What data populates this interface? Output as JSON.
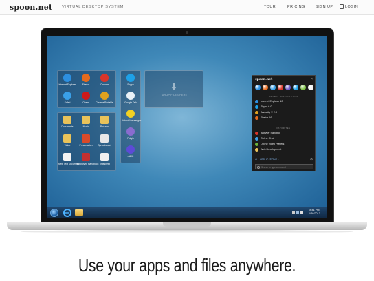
{
  "header": {
    "logo": "spoon.net",
    "tagline": "VIRTUAL DESKTOP SYSTEM",
    "nav": {
      "tour": "TOUR",
      "pricing": "PRICING",
      "signup": "SIGN UP",
      "login": "LOGIN"
    }
  },
  "desktop": {
    "group_browsers": [
      {
        "label": "Internet Explorer",
        "icon": "ie-icon",
        "color": "#2d8fe0"
      },
      {
        "label": "Firefox",
        "icon": "firefox-icon",
        "color": "#e66a1c"
      },
      {
        "label": "Chrome",
        "icon": "chrome-icon",
        "color": "#d8352a"
      },
      {
        "label": "Safari",
        "icon": "safari-icon",
        "color": "#3aa0e8"
      },
      {
        "label": "Opera",
        "icon": "opera-icon",
        "color": "#cc1a1a"
      },
      {
        "label": "Chrome Portable",
        "icon": "chrome-icon",
        "color": "#e0a21f"
      }
    ],
    "group_social": [
      {
        "label": "Skype",
        "icon": "skype-icon",
        "color": "#1ea1e8"
      },
      {
        "label": "Google Talk",
        "icon": "chat-icon",
        "color": "#e9f1f7"
      },
      {
        "label": "Yahoo! Messenger",
        "icon": "yahoo-icon",
        "color": "#f3d223"
      },
      {
        "label": "Pidgin",
        "icon": "pidgin-icon",
        "color": "#8a6ccf"
      },
      {
        "label": "mIRC",
        "icon": "mirc-icon",
        "color": "#5d4bd6"
      }
    ],
    "group_documents": [
      {
        "label": "Documents",
        "icon": "folder-icon",
        "color": "#e9c35a"
      },
      {
        "label": "Music",
        "icon": "folder-icon",
        "color": "#e9c35a"
      },
      {
        "label": "Pictures",
        "icon": "folder-icon",
        "color": "#e9c35a"
      },
      {
        "label": "Video",
        "icon": "folder-icon",
        "color": "#e9c35a"
      },
      {
        "label": "Presentation",
        "icon": "document-icon",
        "color": "#d94a2a"
      },
      {
        "label": "Spreadsheet",
        "icon": "document-icon",
        "color": "#e8e8e8"
      },
      {
        "label": "New Text Document",
        "icon": "document-icon",
        "color": "#f2f2f2"
      },
      {
        "label": "Employee Handbook",
        "icon": "document-icon",
        "color": "#c23030"
      },
      {
        "label": "Timesheet",
        "icon": "document-icon",
        "color": "#f0f0f0"
      }
    ],
    "drop_zone_label": "DROP FILES HERE"
  },
  "app_panel": {
    "logo": "spoon.net",
    "close": "×",
    "sections": [
      "RECENT APPLICATIONS",
      "FAVORITES"
    ],
    "recent": [
      {
        "label": "Internet Explorer 10",
        "color": "#2d8fe0"
      },
      {
        "label": "Skype 6.0",
        "color": "#1ea1e8"
      },
      {
        "label": "Audacity ® 2.0",
        "color": "#e0a21f"
      },
      {
        "label": "Firefox 16",
        "color": "#e66a1c"
      }
    ],
    "favorites": [
      {
        "label": "Browser Sandbox",
        "color": "#d8352a"
      },
      {
        "label": "Online Chat",
        "color": "#3aa0e8"
      },
      {
        "label": "Online Video Players",
        "color": "#6bb33a"
      },
      {
        "label": "Web Development",
        "color": "#e9c35a"
      }
    ],
    "globes": [
      "#2d8fe0",
      "#e66a1c",
      "#3aa0e8",
      "#d8352a",
      "#6b58c9",
      "#1ea1e8",
      "#7bc043",
      "#f2f2f2"
    ],
    "all_apps": "ALL APPLICATIONS ▸",
    "search_placeholder": "Search or type command"
  },
  "taskbar": {
    "time": "8:41 PM",
    "date": "1/26/2013"
  },
  "hero": {
    "headline": "Use your apps and files anywhere."
  },
  "colors": {
    "desktop_bg": "#3f88b8",
    "panel_bg": "#1b1b1b",
    "accent_link": "#8ec4ff"
  }
}
